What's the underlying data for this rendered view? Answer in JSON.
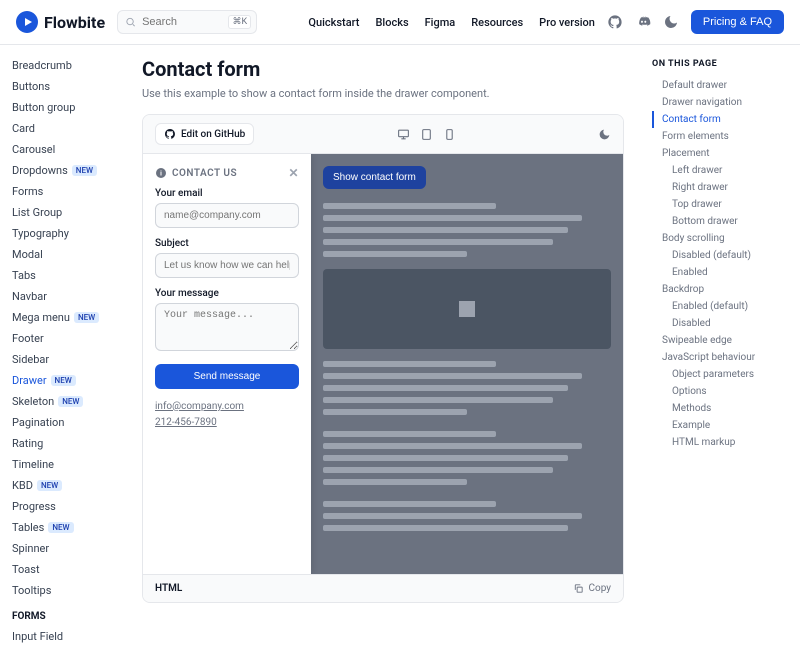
{
  "header": {
    "brand": "Flowbite",
    "search_placeholder": "Search",
    "search_kbd": "⌘K",
    "nav": [
      "Quickstart",
      "Blocks",
      "Figma",
      "Resources",
      "Pro version"
    ],
    "cta": "Pricing & FAQ"
  },
  "sidebar": {
    "items": [
      {
        "label": "Breadcrumb"
      },
      {
        "label": "Buttons"
      },
      {
        "label": "Button group"
      },
      {
        "label": "Card"
      },
      {
        "label": "Carousel"
      },
      {
        "label": "Dropdowns",
        "new": true
      },
      {
        "label": "Forms"
      },
      {
        "label": "List Group"
      },
      {
        "label": "Typography"
      },
      {
        "label": "Modal"
      },
      {
        "label": "Tabs"
      },
      {
        "label": "Navbar"
      },
      {
        "label": "Mega menu",
        "new": true
      },
      {
        "label": "Footer"
      },
      {
        "label": "Sidebar"
      },
      {
        "label": "Drawer",
        "new": true,
        "active": true
      },
      {
        "label": "Skeleton",
        "new": true
      },
      {
        "label": "Pagination"
      },
      {
        "label": "Rating"
      },
      {
        "label": "Timeline"
      },
      {
        "label": "KBD",
        "new": true
      },
      {
        "label": "Progress"
      },
      {
        "label": "Tables",
        "new": true
      },
      {
        "label": "Spinner"
      },
      {
        "label": "Toast"
      },
      {
        "label": "Tooltips"
      }
    ],
    "heading2": "FORMS",
    "items2": [
      {
        "label": "Input Field"
      }
    ],
    "new_badge": "NEW"
  },
  "page": {
    "title": "Contact form",
    "subtitle": "Use this example to show a contact form inside the drawer component.",
    "edit_label": "Edit on GitHub"
  },
  "drawer": {
    "heading": "CONTACT US",
    "email_label": "Your email",
    "email_placeholder": "name@company.com",
    "subject_label": "Subject",
    "subject_placeholder": "Let us know how we can help you",
    "message_label": "Your message",
    "message_placeholder": "Your message...",
    "submit": "Send message",
    "contact_email": "info@company.com",
    "contact_phone": "212-456-7890",
    "show_btn": "Show contact form"
  },
  "code_footer": {
    "tab": "HTML",
    "copy": "Copy"
  },
  "toc": {
    "heading": "ON THIS PAGE",
    "items": [
      {
        "label": "Default drawer"
      },
      {
        "label": "Drawer navigation"
      },
      {
        "label": "Contact form",
        "active": true
      },
      {
        "label": "Form elements"
      },
      {
        "label": "Placement"
      },
      {
        "label": "Left drawer",
        "sub": true
      },
      {
        "label": "Right drawer",
        "sub": true
      },
      {
        "label": "Top drawer",
        "sub": true
      },
      {
        "label": "Bottom drawer",
        "sub": true
      },
      {
        "label": "Body scrolling"
      },
      {
        "label": "Disabled (default)",
        "sub": true
      },
      {
        "label": "Enabled",
        "sub": true
      },
      {
        "label": "Backdrop"
      },
      {
        "label": "Enabled (default)",
        "sub": true
      },
      {
        "label": "Disabled",
        "sub": true
      },
      {
        "label": "Swipeable edge"
      },
      {
        "label": "JavaScript behaviour"
      },
      {
        "label": "Object parameters",
        "sub": true
      },
      {
        "label": "Options",
        "sub": true
      },
      {
        "label": "Methods",
        "sub": true
      },
      {
        "label": "Example",
        "sub": true
      },
      {
        "label": "HTML markup",
        "sub": true
      }
    ]
  }
}
